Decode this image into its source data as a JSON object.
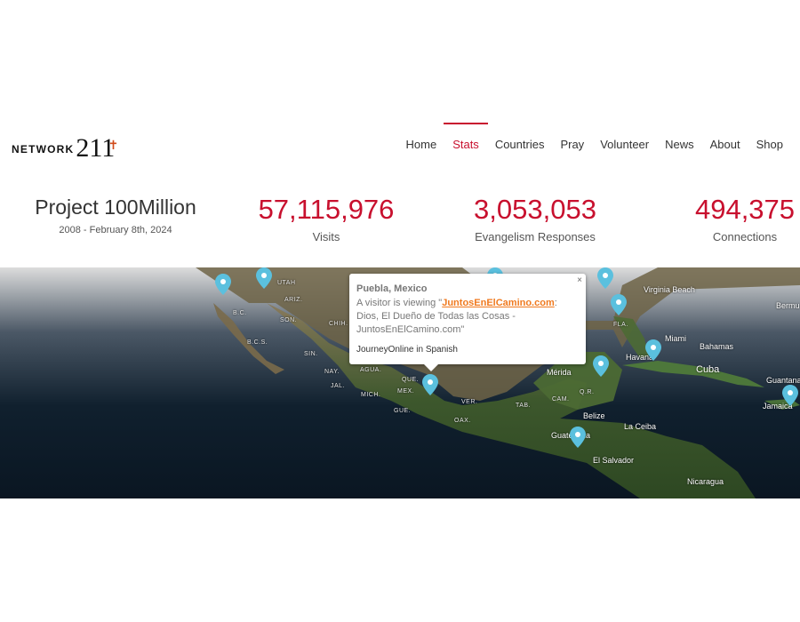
{
  "brand": {
    "logo_word": "NETWORK",
    "logo_num": "211"
  },
  "nav": {
    "items": [
      "Home",
      "Stats",
      "Countries",
      "Pray",
      "Volunteer",
      "News",
      "About",
      "Shop"
    ],
    "active": "Stats"
  },
  "stats": {
    "project_title": "Project 100Million",
    "project_dates": "2008 - February 8th, 2024",
    "visits_value": "57,115,976",
    "visits_label": "Visits",
    "evangelism_value": "3,053,053",
    "evangelism_label": "Evangelism Responses",
    "connections_value": "494,375",
    "connections_label": "Connections"
  },
  "map": {
    "labels": {
      "virginia_beach": "Virginia Beach",
      "bermuda": "Bermu",
      "miami": "Miami",
      "bahamas": "Bahamas",
      "havana": "Havana",
      "cuba": "Cuba",
      "merida": "Mérida",
      "guantanamo": "Guantanam",
      "jamaica": "Jamaica",
      "belize": "Belize",
      "la_ceiba": "La Ceiba",
      "guatemala": "Guatemala",
      "el_salvador": "El Salvador",
      "nicaragua": "Nicaragua",
      "fla": "FLA.",
      "son": "SON.",
      "chih": "CHIH.",
      "sin": "SIN.",
      "nay": "NAY.",
      "jal": "JAL.",
      "mich": "MICH.",
      "mex": "MEX.",
      "gue": "GUE.",
      "oax": "OAX.",
      "ver": "VER.",
      "tab": "TAB.",
      "cam": "CAM.",
      "qr": "Q.R.",
      "que": "QUE.",
      "agua": "AGUA.",
      "ariz": "ARIZ.",
      "bc": "B.C.",
      "bcs": "B.C.S.",
      "utah": "UTAH"
    },
    "pin_color": "#5bc0de",
    "popup": {
      "location": "Puebla, Mexico",
      "prefix": "A visitor is viewing \"",
      "link": "JuntosEnElCamino.com",
      "suffix": ": Dios, El Dueño de Todas las Cosas - JuntosEnElCamino.com\"",
      "sub": "JourneyOnline in Spanish",
      "close": "×"
    }
  },
  "colors": {
    "accent": "#c8102e",
    "link": "#f07a1f"
  }
}
